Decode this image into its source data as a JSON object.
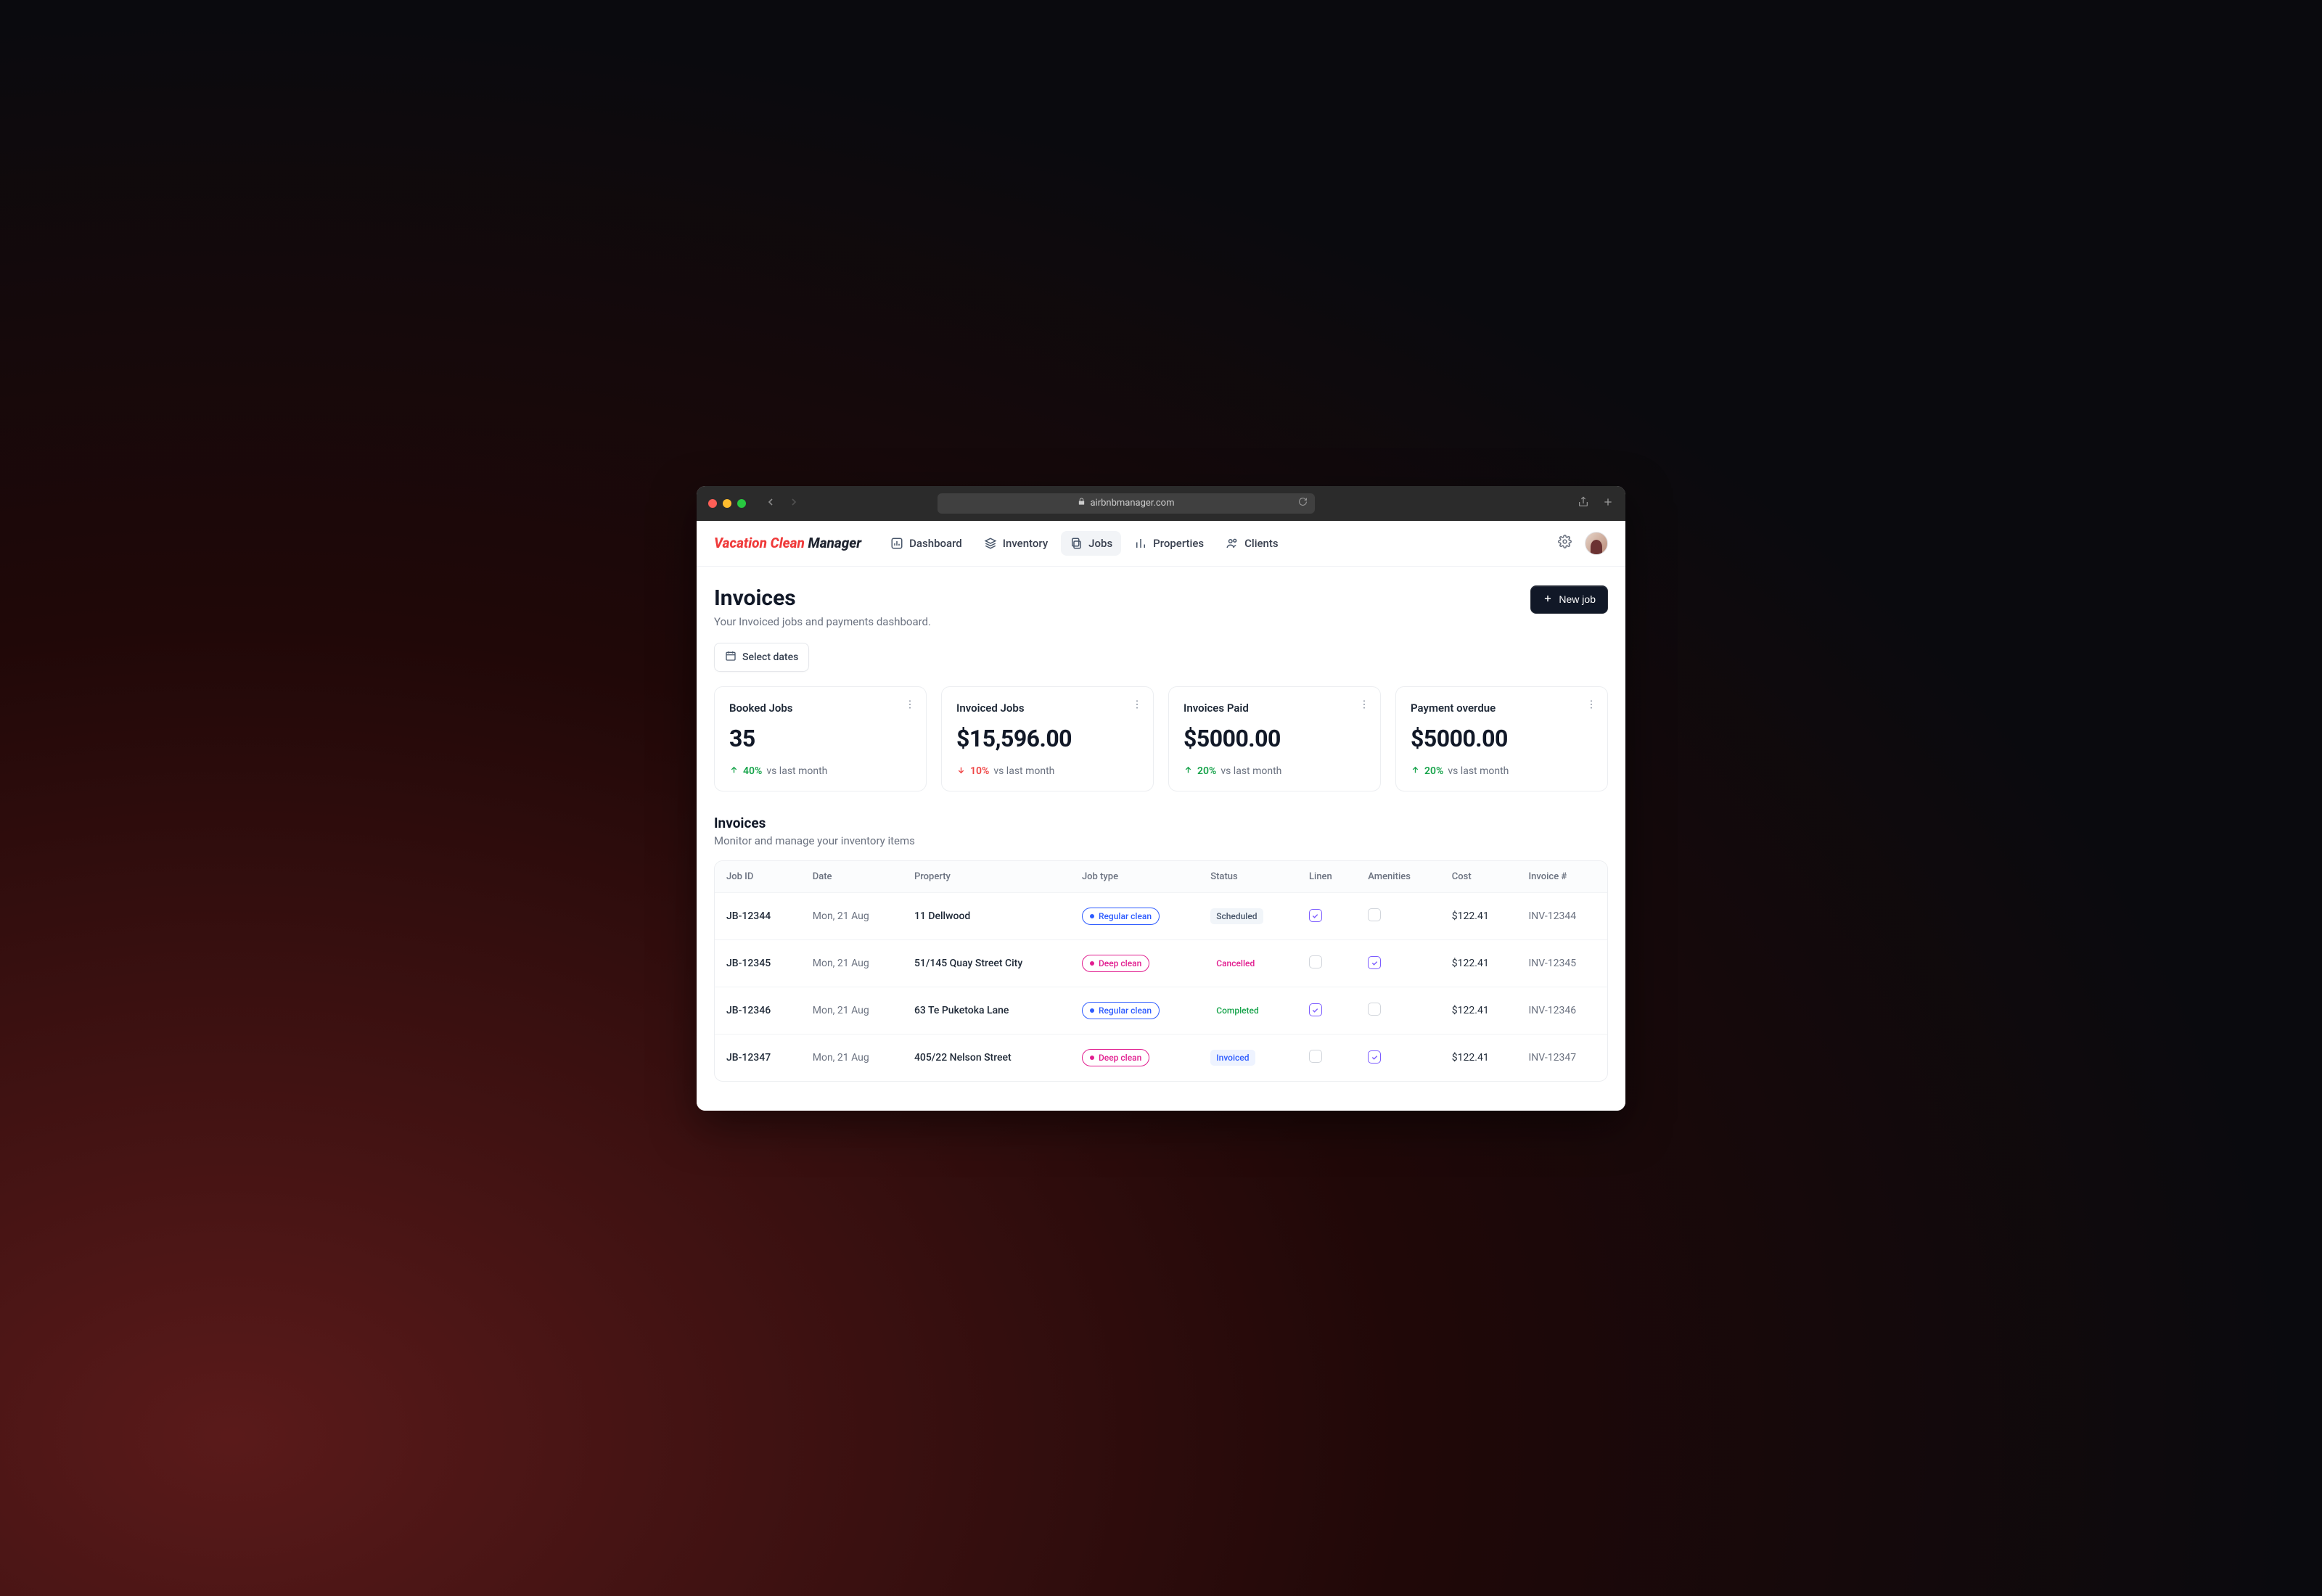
{
  "browser": {
    "url": "airbnbmanager.com"
  },
  "brand": {
    "accent": "Vacation Clean",
    "rest": "Manager"
  },
  "nav": {
    "dashboard": "Dashboard",
    "inventory": "Inventory",
    "jobs": "Jobs",
    "properties": "Properties",
    "clients": "Clients"
  },
  "page": {
    "title": "Invoices",
    "subtitle": "Your Invoiced jobs and payments dashboard.",
    "new_job_label": "New job",
    "select_dates_label": "Select dates"
  },
  "stats": [
    {
      "label": "Booked Jobs",
      "value": "35",
      "trend_dir": "up",
      "trend_pct": "40%",
      "trend_vs": "vs last month"
    },
    {
      "label": "Invoiced Jobs",
      "value": "$15,596.00",
      "trend_dir": "down",
      "trend_pct": "10%",
      "trend_vs": "vs last month"
    },
    {
      "label": "Invoices Paid",
      "value": "$5000.00",
      "trend_dir": "up",
      "trend_pct": "20%",
      "trend_vs": "vs last month"
    },
    {
      "label": "Payment overdue",
      "value": "$5000.00",
      "trend_dir": "up",
      "trend_pct": "20%",
      "trend_vs": "vs last month"
    }
  ],
  "section": {
    "title": "Invoices",
    "subtitle": "Monitor and manage your inventory items"
  },
  "table": {
    "headers": {
      "job_id": "Job ID",
      "date": "Date",
      "property": "Property",
      "job_type": "Job type",
      "status": "Status",
      "linen": "Linen",
      "amenities": "Amenities",
      "cost": "Cost",
      "invoice": "Invoice #"
    },
    "rows": [
      {
        "job_id": "JB-12344",
        "date": "Mon, 21 Aug",
        "property": "11 Dellwood",
        "job_type": "Regular clean",
        "job_type_kind": "regular",
        "status": "Scheduled",
        "status_kind": "scheduled",
        "linen": true,
        "amenities": false,
        "cost": "$122.41",
        "invoice": "INV-12344"
      },
      {
        "job_id": "JB-12345",
        "date": "Mon, 21 Aug",
        "property": "51/145 Quay Street City",
        "job_type": "Deep clean",
        "job_type_kind": "deep",
        "status": "Cancelled",
        "status_kind": "cancelled",
        "linen": false,
        "amenities": true,
        "cost": "$122.41",
        "invoice": "INV-12345"
      },
      {
        "job_id": "JB-12346",
        "date": "Mon, 21 Aug",
        "property": "63 Te Puketoka Lane",
        "job_type": "Regular clean",
        "job_type_kind": "regular",
        "status": "Completed",
        "status_kind": "completed",
        "linen": true,
        "amenities": false,
        "cost": "$122.41",
        "invoice": "INV-12346"
      },
      {
        "job_id": "JB-12347",
        "date": "Mon, 21 Aug",
        "property": "405/22 Nelson Street",
        "job_type": "Deep clean",
        "job_type_kind": "deep",
        "status": "Invoiced",
        "status_kind": "invoiced",
        "linen": false,
        "amenities": true,
        "cost": "$122.41",
        "invoice": "INV-12347"
      }
    ]
  }
}
